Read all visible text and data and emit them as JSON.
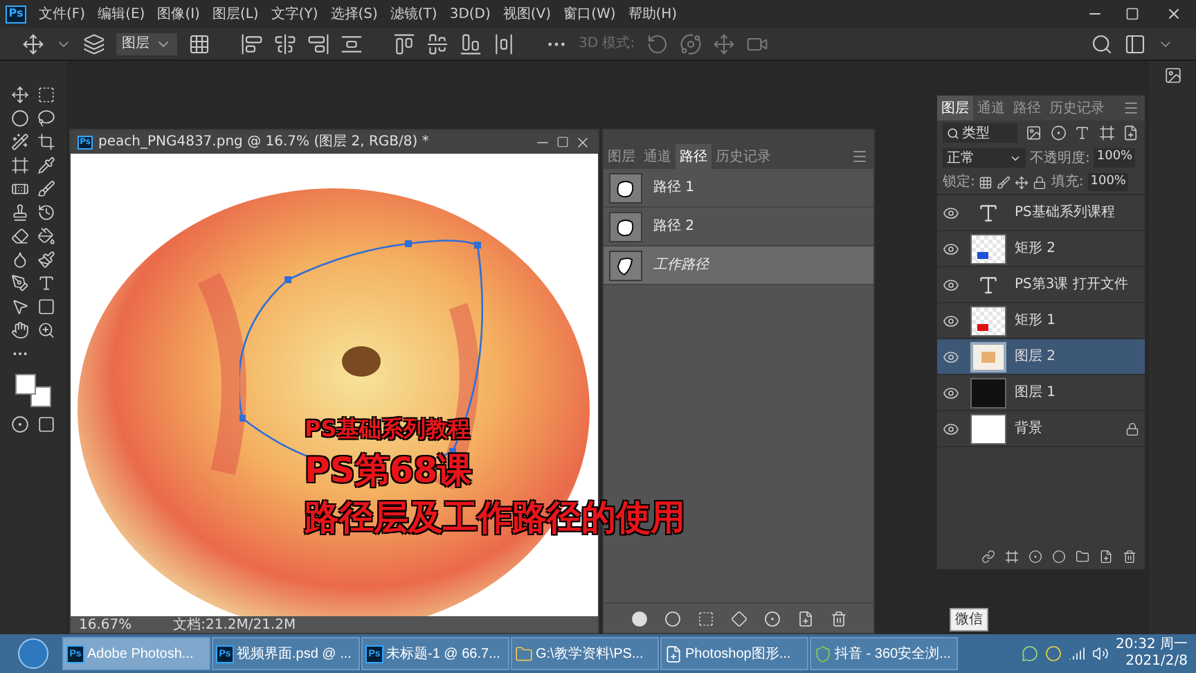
{
  "app": {
    "logo": "Ps"
  },
  "menu": [
    "文件(F)",
    "编辑(E)",
    "图像(I)",
    "图层(L)",
    "文字(Y)",
    "选择(S)",
    "滤镜(T)",
    "3D(D)",
    "视图(V)",
    "窗口(W)",
    "帮助(H)"
  ],
  "options_bar": {
    "target": "图层",
    "mode_label": "3D 模式:"
  },
  "document": {
    "logo": "Ps",
    "title": "peach_PNG4837.png @ 16.7% (图层 2, RGB/8) *",
    "zoom": "16.67%",
    "doc_info": "文档:21.2M/21.2M",
    "overlay": [
      "PS基础系列教程",
      "PS第68课",
      "路径层及工作路径的使用"
    ]
  },
  "paths_panel": {
    "tabs": [
      {
        "label": "图层",
        "selected": false
      },
      {
        "label": "通道",
        "selected": false
      },
      {
        "label": "路径",
        "selected": true
      },
      {
        "label": "历史记录",
        "selected": false
      }
    ],
    "paths": [
      {
        "name": "路径 1",
        "kind": "saved",
        "selected": false
      },
      {
        "name": "路径 2",
        "kind": "saved",
        "selected": false
      },
      {
        "name": "工作路径",
        "kind": "work",
        "selected": true
      }
    ]
  },
  "layers_panel": {
    "tabs": [
      {
        "label": "图层",
        "selected": true
      },
      {
        "label": "通道",
        "selected": false
      },
      {
        "label": "路径",
        "selected": false
      },
      {
        "label": "历史记录",
        "selected": false
      }
    ],
    "filter": "类型",
    "blend_mode": "正常",
    "opacity_label": "不透明度:",
    "opacity": "100%",
    "lock_label": "锁定:",
    "fill_label": "填充:",
    "fill": "100%",
    "layers": [
      {
        "name": "PS基础系列课程",
        "kind": "text",
        "visible": true,
        "selected": false,
        "locked": false
      },
      {
        "name": "矩形 2",
        "kind": "shape",
        "color": "#1e4fd8",
        "visible": true,
        "selected": false,
        "locked": false
      },
      {
        "name": "PS第3课 打开文件",
        "kind": "text",
        "visible": true,
        "selected": false,
        "locked": false
      },
      {
        "name": "矩形 1",
        "kind": "shape",
        "color": "#e01010",
        "visible": true,
        "selected": false,
        "locked": false
      },
      {
        "name": "图层 2",
        "kind": "pixel",
        "visible": true,
        "selected": true,
        "locked": false
      },
      {
        "name": "图层 1",
        "kind": "fill",
        "color": "#111111",
        "visible": true,
        "selected": false,
        "locked": false
      },
      {
        "name": "背景",
        "kind": "fill",
        "color": "#ffffff",
        "visible": true,
        "selected": false,
        "locked": true
      }
    ]
  },
  "tooltip": "微信",
  "taskbar": {
    "items": [
      {
        "label": "Adobe Photosh...",
        "kind": "ps",
        "logo": "Ps",
        "selected": true
      },
      {
        "label": "视频界面.psd @ ...",
        "kind": "ps",
        "logo": "Ps",
        "selected": false
      },
      {
        "label": "未标题-1 @ 66.7...",
        "kind": "ps",
        "logo": "Ps",
        "selected": false
      },
      {
        "label": "G:\\教学资料\\PS...",
        "kind": "folder",
        "selected": false
      },
      {
        "label": "Photoshop图形...",
        "kind": "document",
        "selected": false
      },
      {
        "label": "抖音 - 360安全浏...",
        "kind": "browser",
        "selected": false
      }
    ],
    "time": "20:32 周一",
    "date": "2021/2/8"
  }
}
